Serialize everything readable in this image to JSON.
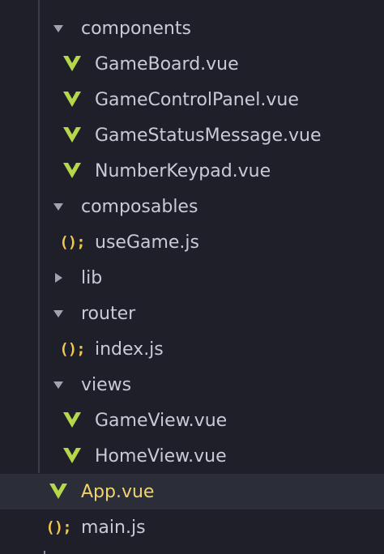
{
  "explorer": {
    "items": [
      {
        "kind": "folder",
        "expanded": true,
        "label": "components"
      },
      {
        "kind": "file",
        "icon": "vue-icon",
        "label": "GameBoard.vue"
      },
      {
        "kind": "file",
        "icon": "vue-icon",
        "label": "GameControlPanel.vue"
      },
      {
        "kind": "file",
        "icon": "vue-icon",
        "label": "GameStatusMessage.vue"
      },
      {
        "kind": "file",
        "icon": "vue-icon",
        "label": "NumberKeypad.vue"
      },
      {
        "kind": "folder",
        "expanded": true,
        "label": "composables"
      },
      {
        "kind": "file",
        "icon": "javascript-icon",
        "label": "useGame.js"
      },
      {
        "kind": "folder",
        "expanded": false,
        "label": "lib"
      },
      {
        "kind": "folder",
        "expanded": true,
        "label": "router"
      },
      {
        "kind": "file",
        "icon": "javascript-icon",
        "label": "index.js"
      },
      {
        "kind": "folder",
        "expanded": true,
        "label": "views"
      },
      {
        "kind": "file",
        "icon": "vue-icon",
        "label": "GameView.vue"
      },
      {
        "kind": "file",
        "icon": "vue-icon",
        "label": "HomeView.vue"
      },
      {
        "kind": "file",
        "icon": "vue-icon",
        "label": "App.vue",
        "selected": true
      },
      {
        "kind": "file",
        "icon": "javascript-icon",
        "label": "main.js"
      }
    ],
    "js_icon_glyph": "();"
  },
  "colors": {
    "background": "#1e1f29",
    "selected_row": "#2b2d39",
    "text": "#c8cad6",
    "active_text": "#f1d36d",
    "vue_icon": "#b4d84a",
    "js_icon": "#f0c74c"
  }
}
